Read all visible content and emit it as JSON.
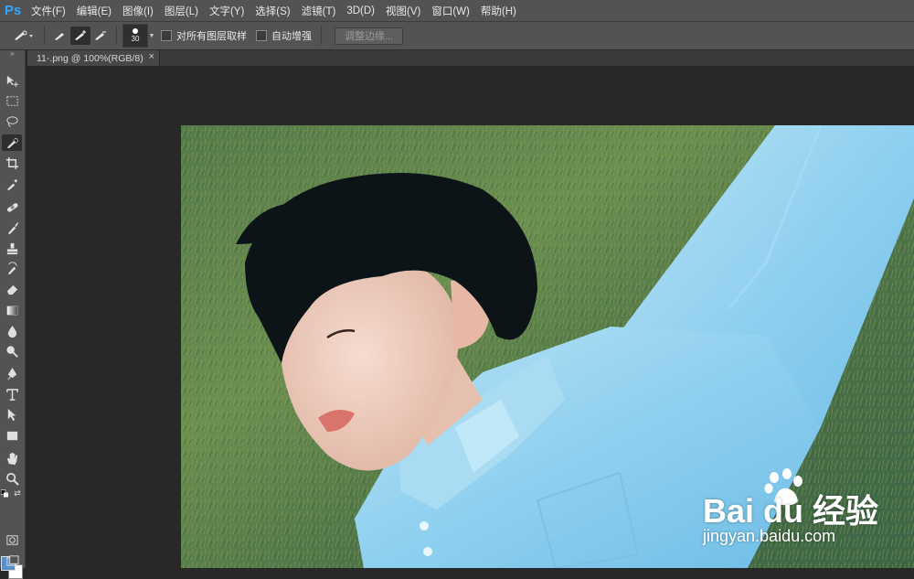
{
  "app": {
    "logo": "Ps"
  },
  "menu": [
    "文件(F)",
    "编辑(E)",
    "图像(I)",
    "图层(L)",
    "文字(Y)",
    "选择(S)",
    "滤镜(T)",
    "3D(D)",
    "视图(V)",
    "窗口(W)",
    "帮助(H)"
  ],
  "options": {
    "brush_size": "30",
    "sample_all_layers": "对所有图层取样",
    "auto_enhance": "自动增强",
    "refine_edge": "调整边缘..."
  },
  "document": {
    "tab_title": "11-.png @ 100%(RGB/8)",
    "close": "×"
  },
  "colors": {
    "foreground": "#5b8fc9",
    "background": "#ffffff",
    "accent": "#31a8ff"
  },
  "watermark": {
    "logo": "Bai du 经验",
    "url": "jingyan.baidu.com"
  },
  "toolbar": [
    "move-tool",
    "marquee-tool",
    "lasso-tool",
    "quick-selection-tool",
    "crop-tool",
    "eyedropper-tool",
    "healing-brush-tool",
    "brush-tool",
    "clone-stamp-tool",
    "history-brush-tool",
    "eraser-tool",
    "gradient-tool",
    "blur-tool",
    "dodge-tool",
    "pen-tool",
    "type-tool",
    "path-selection-tool",
    "rectangle-tool",
    "hand-tool",
    "zoom-tool"
  ]
}
